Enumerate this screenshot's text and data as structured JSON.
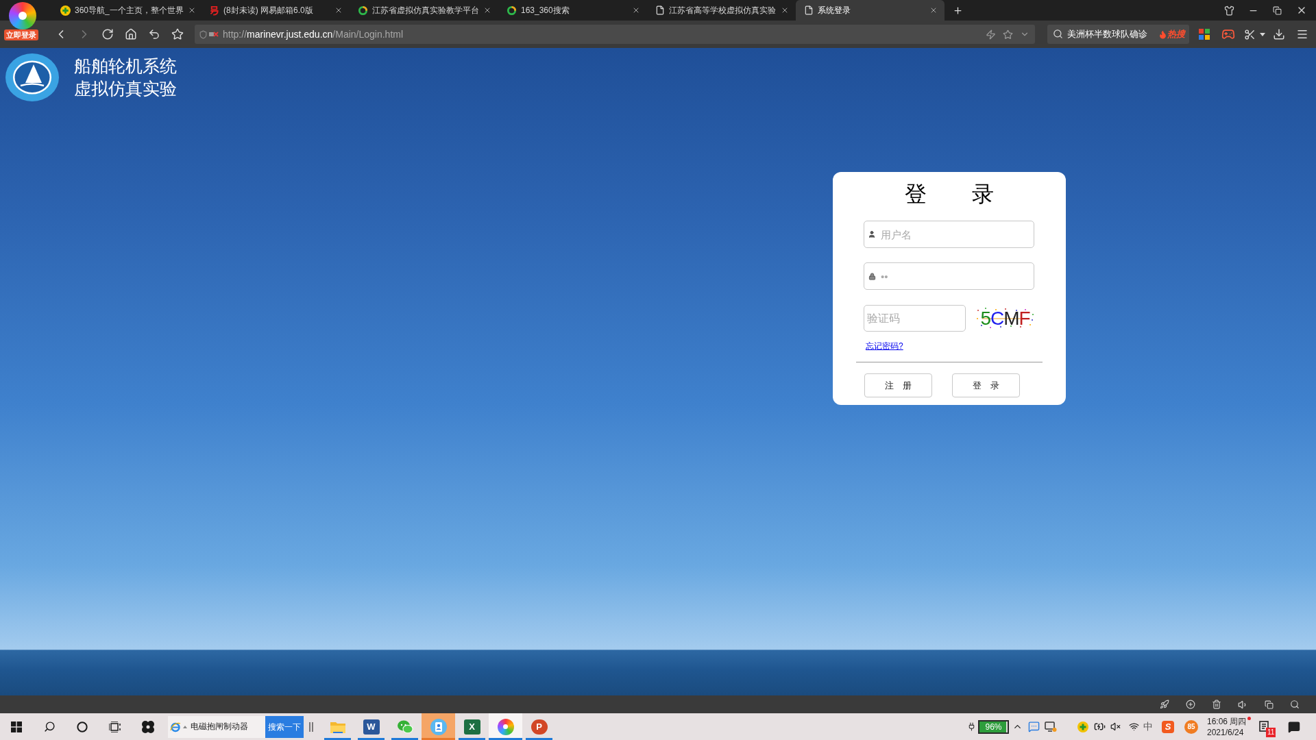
{
  "browser": {
    "account_badge": "立即登录",
    "tabs": [
      {
        "kind": "plus",
        "title": "360导航_一个主页，整个世界",
        "selected": false
      },
      {
        "kind": "mark",
        "title": "(8封未读) 网易邮箱6.0版",
        "selected": false
      },
      {
        "kind": "ring",
        "title": "江苏省虚拟仿真实验教学平台",
        "selected": false
      },
      {
        "kind": "ring",
        "title": "163_360搜索",
        "selected": false
      },
      {
        "kind": "page",
        "title": "江苏省高等学校虚拟仿真实验",
        "selected": false
      },
      {
        "kind": "page",
        "title": "系统登录",
        "selected": true
      }
    ],
    "address": {
      "scheme": "http://",
      "host": "marinevr.just.edu.cn",
      "path": "/Main/Login.html"
    },
    "search": {
      "value": "美洲杯半数球队确诊",
      "hot_label": "热搜"
    }
  },
  "page": {
    "site_title": [
      "船舶轮机系统",
      "虚拟仿真实验"
    ],
    "login": {
      "title": "登 录",
      "fields": [
        {
          "kind": "user",
          "placeholder": "用户名"
        },
        {
          "kind": "password",
          "placeholder": "••"
        }
      ],
      "captcha": {
        "placeholder": "验证码",
        "code": "5CMF"
      },
      "forgot_link": "忘记密码?",
      "buttons": [
        "注 册",
        "登 录"
      ]
    }
  },
  "taskbar": {
    "search": {
      "value": "电磁抱闸制动器",
      "button": "搜索一下"
    },
    "apps": [
      {
        "kind": "folder",
        "running": true,
        "active": false,
        "attention": false
      },
      {
        "kind": "document",
        "letter": "W",
        "running": true,
        "active": false,
        "attention": false
      },
      {
        "kind": "chat",
        "running": true,
        "active": false,
        "attention": false
      },
      {
        "kind": "badge",
        "running": true,
        "active": false,
        "attention": true
      },
      {
        "kind": "sheet",
        "letter": "X",
        "running": true,
        "active": false,
        "attention": false
      },
      {
        "kind": "browser",
        "running": true,
        "active": true,
        "attention": false
      },
      {
        "kind": "slides",
        "letter": "P",
        "running": true,
        "active": false,
        "attention": false
      }
    ],
    "tray": {
      "battery": {
        "level": 0.96,
        "reading": "96%"
      },
      "ime": "中",
      "ime_logo": "S",
      "counter": "85",
      "time": "16:06 周四",
      "date": "2021/6/24",
      "notifications": "11"
    }
  }
}
